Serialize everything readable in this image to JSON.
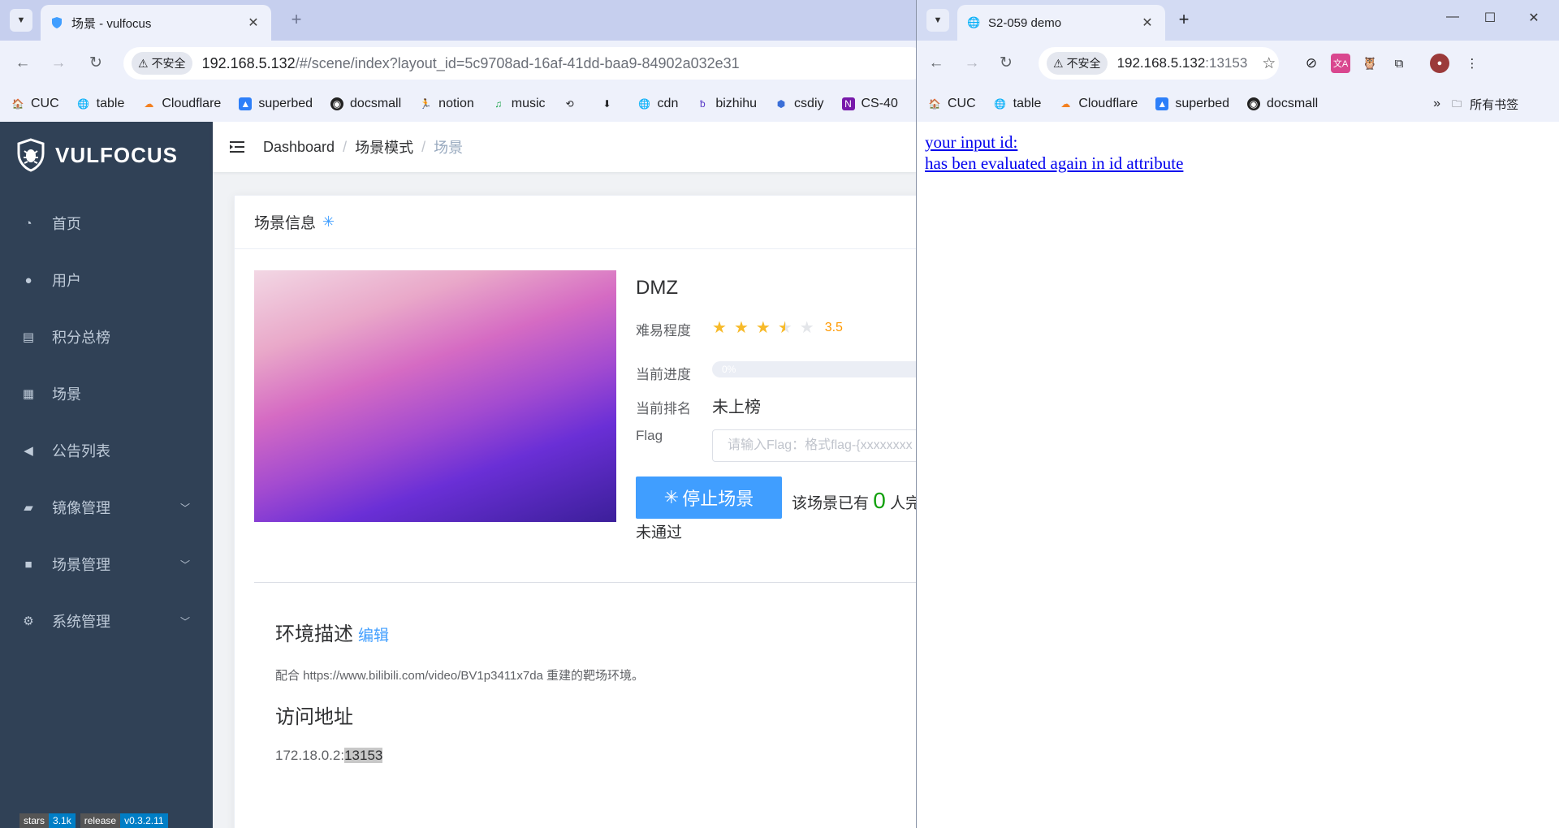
{
  "left_window": {
    "tab": {
      "title": "场景 - vulfocus"
    },
    "address": {
      "security": "不安全",
      "host": "192.168.5.132",
      "path": "/#/scene/index?layout_id=5c9708ad-16af-41dd-baa9-84902a032e31"
    },
    "bookmarks": [
      "CUC",
      "table",
      "Cloudflare",
      "superbed",
      "docsmall",
      "notion",
      "music",
      "",
      "",
      "cdn",
      "bizhihu",
      "csdiy",
      "CS-40"
    ],
    "app": {
      "brand": "VULFOCUS",
      "menu": [
        {
          "label": "首页",
          "icon": "dashboard-icon"
        },
        {
          "label": "用户",
          "icon": "user-icon"
        },
        {
          "label": "积分总榜",
          "icon": "ranking-icon"
        },
        {
          "label": "场景",
          "icon": "grid-icon"
        },
        {
          "label": "公告列表",
          "icon": "announcement-icon"
        },
        {
          "label": "镜像管理",
          "icon": "docker-icon",
          "expandable": true
        },
        {
          "label": "场景管理",
          "icon": "scene-icon",
          "expandable": true
        },
        {
          "label": "系统管理",
          "icon": "gear-icon",
          "expandable": true
        }
      ],
      "badges": [
        {
          "key": "stars",
          "value": "3.1k"
        },
        {
          "key": "release",
          "value": "v0.3.2.11"
        }
      ],
      "breadcrumb": [
        "Dashboard",
        "场景模式",
        "场景"
      ],
      "card_title": "场景信息",
      "scene": {
        "name": "DMZ",
        "difficulty_label": "难易程度",
        "rating": 3.5,
        "rating_text": "3.5",
        "progress_label": "当前进度",
        "progress_text": "0%",
        "progress_fraction": 0,
        "rank_label": "当前排名",
        "rank_value": "未上榜",
        "flag_label": "Flag",
        "flag_placeholder": "请输入Flag：格式flag-{xxxxxxxx",
        "stop_button": "停止场景",
        "passed_prefix": "该场景已有",
        "passed_count": "0",
        "passed_suffix": "人完",
        "status": "未通过"
      },
      "env_title": "环境描述",
      "edit_link": "编辑",
      "env_desc": "配合 https://www.bilibili.com/video/BV1p3411x7da 重建的靶场环境。",
      "access_title": "访问地址",
      "access_host": "172.18.0.2:",
      "access_port": "13153"
    }
  },
  "right_window": {
    "tab": {
      "title": "S2-059 demo"
    },
    "address": {
      "security": "不安全",
      "host": "192.168.5.132",
      "port": ":13153"
    },
    "bookmarks": [
      "CUC",
      "table",
      "Cloudflare",
      "superbed",
      "docsmall"
    ],
    "all_bookmarks": "所有书签",
    "page": {
      "line1": "your input id:",
      "line2": "has ben evaluated again in id attribute"
    }
  },
  "colors": {
    "sidebar": "#304156",
    "accent": "#409eff",
    "star": "#f7ba2a",
    "link": "#0000ee"
  }
}
